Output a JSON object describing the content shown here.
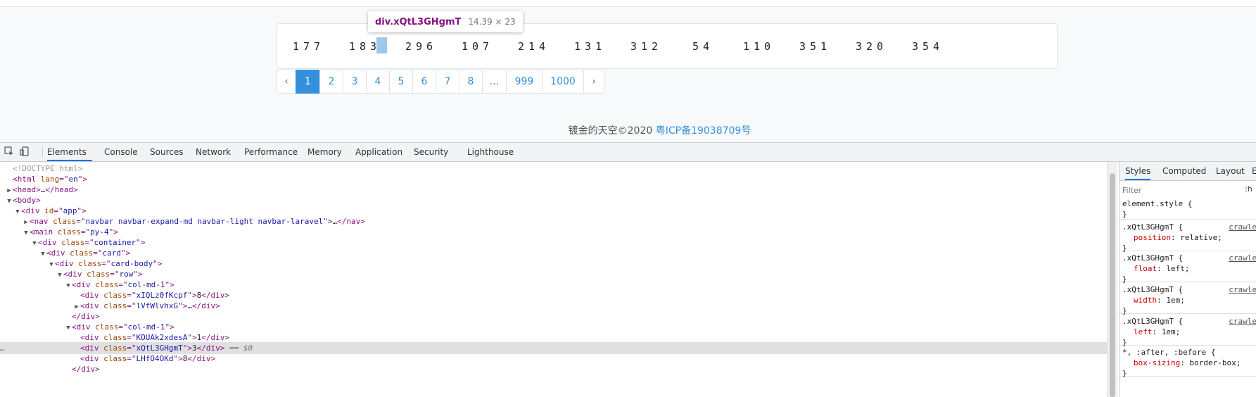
{
  "numbers": [
    "177",
    "183",
    "296",
    "107",
    "214",
    "131",
    "312",
    "54",
    "110",
    "351",
    "320",
    "354"
  ],
  "tooltip": {
    "selector": "div.xQtL3GHgmT",
    "size": "14.39 × 23"
  },
  "pagination": {
    "prev": "‹",
    "pages": [
      "1",
      "2",
      "3",
      "4",
      "5",
      "6",
      "7",
      "8",
      "…",
      "999",
      "1000"
    ],
    "next": "›",
    "active": "1"
  },
  "footer": {
    "text": "镀金的天空©2020 ",
    "icp": "粤ICP备19038709号"
  },
  "devtools": {
    "tabs": [
      "Elements",
      "Console",
      "Sources",
      "Network",
      "Performance",
      "Memory",
      "Application",
      "Security",
      "Lighthouse"
    ],
    "active_tab": "Elements",
    "dom": [
      {
        "indent": 0,
        "arrow": "",
        "html": "<!DOCTYPE html>",
        "type": "comment"
      },
      {
        "indent": 0,
        "arrow": "",
        "tag": "html",
        "attrs": [
          [
            "lang",
            "en"
          ]
        ],
        "close": false
      },
      {
        "indent": 0,
        "arrow": "▶",
        "tag": "head",
        "attrs": [],
        "collapsed": true
      },
      {
        "indent": 0,
        "arrow": "▼",
        "tag": "body",
        "attrs": [],
        "close": false
      },
      {
        "indent": 1,
        "arrow": "▼",
        "tag": "div",
        "attrs": [
          [
            "id",
            "app"
          ]
        ],
        "close": false
      },
      {
        "indent": 2,
        "arrow": "▶",
        "tag": "nav",
        "attrs": [
          [
            "class",
            "navbar navbar-expand-md navbar-light navbar-laravel"
          ]
        ],
        "collapsed": true
      },
      {
        "indent": 2,
        "arrow": "▼",
        "tag": "main",
        "attrs": [
          [
            "class",
            "py-4"
          ]
        ],
        "close": false
      },
      {
        "indent": 3,
        "arrow": "▼",
        "tag": "div",
        "attrs": [
          [
            "class",
            "container"
          ]
        ],
        "close": false
      },
      {
        "indent": 4,
        "arrow": "▼",
        "tag": "div",
        "attrs": [
          [
            "class",
            "card"
          ]
        ],
        "close": false
      },
      {
        "indent": 5,
        "arrow": "▼",
        "tag": "div",
        "attrs": [
          [
            "class",
            "card-body"
          ]
        ],
        "close": false
      },
      {
        "indent": 6,
        "arrow": "▼",
        "tag": "div",
        "attrs": [
          [
            "class",
            "row"
          ]
        ],
        "close": false
      },
      {
        "indent": 7,
        "arrow": "▼",
        "tag": "div",
        "attrs": [
          [
            "class",
            "col-md-1"
          ]
        ],
        "close": false
      },
      {
        "indent": 8,
        "arrow": "",
        "tag": "div",
        "attrs": [
          [
            "class",
            "xIQLz0fKcpf"
          ]
        ],
        "text": "8",
        "inline": true
      },
      {
        "indent": 8,
        "arrow": "▶",
        "tag": "div",
        "attrs": [
          [
            "class",
            "lVfWlvhxG"
          ]
        ],
        "collapsed": true
      },
      {
        "indent": 7,
        "arrow": "",
        "closing": "div"
      },
      {
        "indent": 7,
        "arrow": "▼",
        "tag": "div",
        "attrs": [
          [
            "class",
            "col-md-1"
          ]
        ],
        "close": false
      },
      {
        "indent": 8,
        "arrow": "",
        "tag": "div",
        "attrs": [
          [
            "class",
            "KOUAk2xdesA"
          ]
        ],
        "text": "1",
        "inline": true
      },
      {
        "indent": 8,
        "arrow": "",
        "tag": "div",
        "attrs": [
          [
            "class",
            "xQtL3GHgmT"
          ]
        ],
        "text": "3",
        "inline": true,
        "selected": true,
        "suffix": " == $0"
      },
      {
        "indent": 8,
        "arrow": "",
        "tag": "div",
        "attrs": [
          [
            "class",
            "LHfO4OKd"
          ]
        ],
        "text": "8",
        "inline": true
      },
      {
        "indent": 7,
        "arrow": "",
        "closing": "div"
      }
    ]
  },
  "styles_panel": {
    "tabs": [
      "Styles",
      "Computed",
      "Layout",
      "E"
    ],
    "active_tab": "Styles",
    "filter_placeholder": "Filter",
    "hov": ":h",
    "rules": [
      {
        "selector": "element.style {",
        "source": "",
        "prop": "",
        "value": ""
      },
      {
        "selector": ".xQtL3GHgmT {",
        "source": "crawle",
        "prop": "position",
        "value": "relative;"
      },
      {
        "selector": ".xQtL3GHgmT {",
        "source": "crawle",
        "prop": "float",
        "value": "left;"
      },
      {
        "selector": ".xQtL3GHgmT {",
        "source": "crawle",
        "prop": "width",
        "value": "1em;"
      },
      {
        "selector": ".xQtL3GHgmT {",
        "source": "crawle",
        "prop": "left",
        "value": "1em;"
      },
      {
        "selector": "*, :after, :before {",
        "source": "",
        "prop": "box-sizing",
        "value": "border-box;"
      }
    ]
  }
}
